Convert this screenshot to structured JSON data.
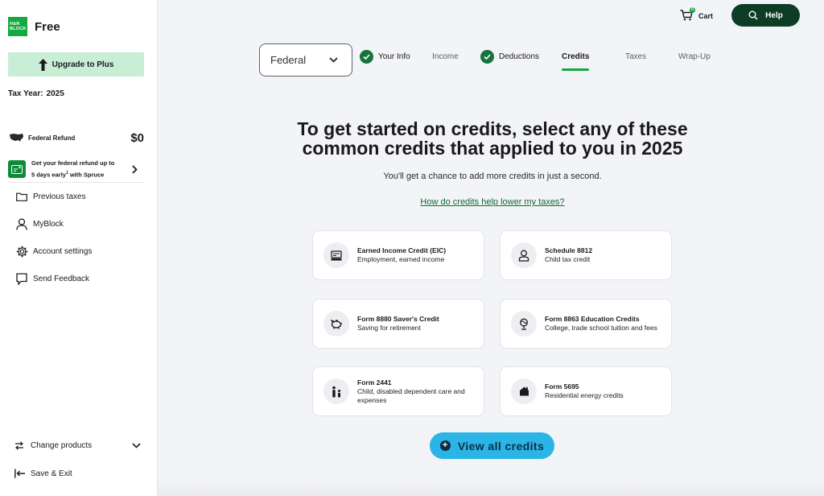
{
  "sidebar": {
    "logo_text": "H&R BLOCK",
    "brand_name": "Free",
    "upgrade_label": "Upgrade to Plus",
    "tax_year_label": "Tax Year:",
    "tax_year_value": "2025",
    "refund_label": "Federal Refund",
    "refund_amount": "$0",
    "spruce_line1": "Get your federal refund up to",
    "spruce_line2a": "5 days early",
    "spruce_sup": "1",
    "spruce_line2b": " with Spruce",
    "nav": {
      "previous_taxes": "Previous taxes",
      "myblock": "MyBlock",
      "account_settings": "Account settings",
      "send_feedback": "Send Feedback"
    },
    "change_products": "Change products",
    "save_exit": "Save & Exit"
  },
  "header": {
    "cart_label": "Cart",
    "cart_count": "0",
    "help_label": "Help"
  },
  "return_select": {
    "value": "Federal"
  },
  "steps": {
    "your_info": "Your Info",
    "income": "Income",
    "deductions": "Deductions",
    "credits": "Credits",
    "taxes": "Taxes",
    "wrap_up": "Wrap-Up"
  },
  "main": {
    "headline": "To get started on credits, select any of these common credits that applied to you in 2025",
    "subtext": "You'll get a chance to add more credits in just a second.",
    "help_link": "How do credits help lower my taxes?",
    "view_all": "View all credits"
  },
  "cards": [
    {
      "title": "Earned Income Credit (EIC)",
      "desc": "Employment, earned income",
      "icon": "register-icon"
    },
    {
      "title": "Schedule 8812",
      "desc": "Child tax credit",
      "icon": "child-icon"
    },
    {
      "title": "Form 8880 Saver's Credit",
      "desc": "Saving for retirement",
      "icon": "piggy-bank-icon"
    },
    {
      "title": "Form 8863 Education Credits",
      "desc": "College, trade school tuition and fees",
      "icon": "globe-icon"
    },
    {
      "title": "Form 2441",
      "desc": "Child, disabled dependent care and expenses",
      "icon": "family-icon"
    },
    {
      "title": "Form 5695",
      "desc": "Residential energy credits",
      "icon": "house-icon"
    }
  ],
  "colors": {
    "brand_green": "#14aa40",
    "dark_green": "#0e3d25",
    "upgrade_bg": "#c9eed6",
    "view_all_bg": "#2bb4e6"
  }
}
